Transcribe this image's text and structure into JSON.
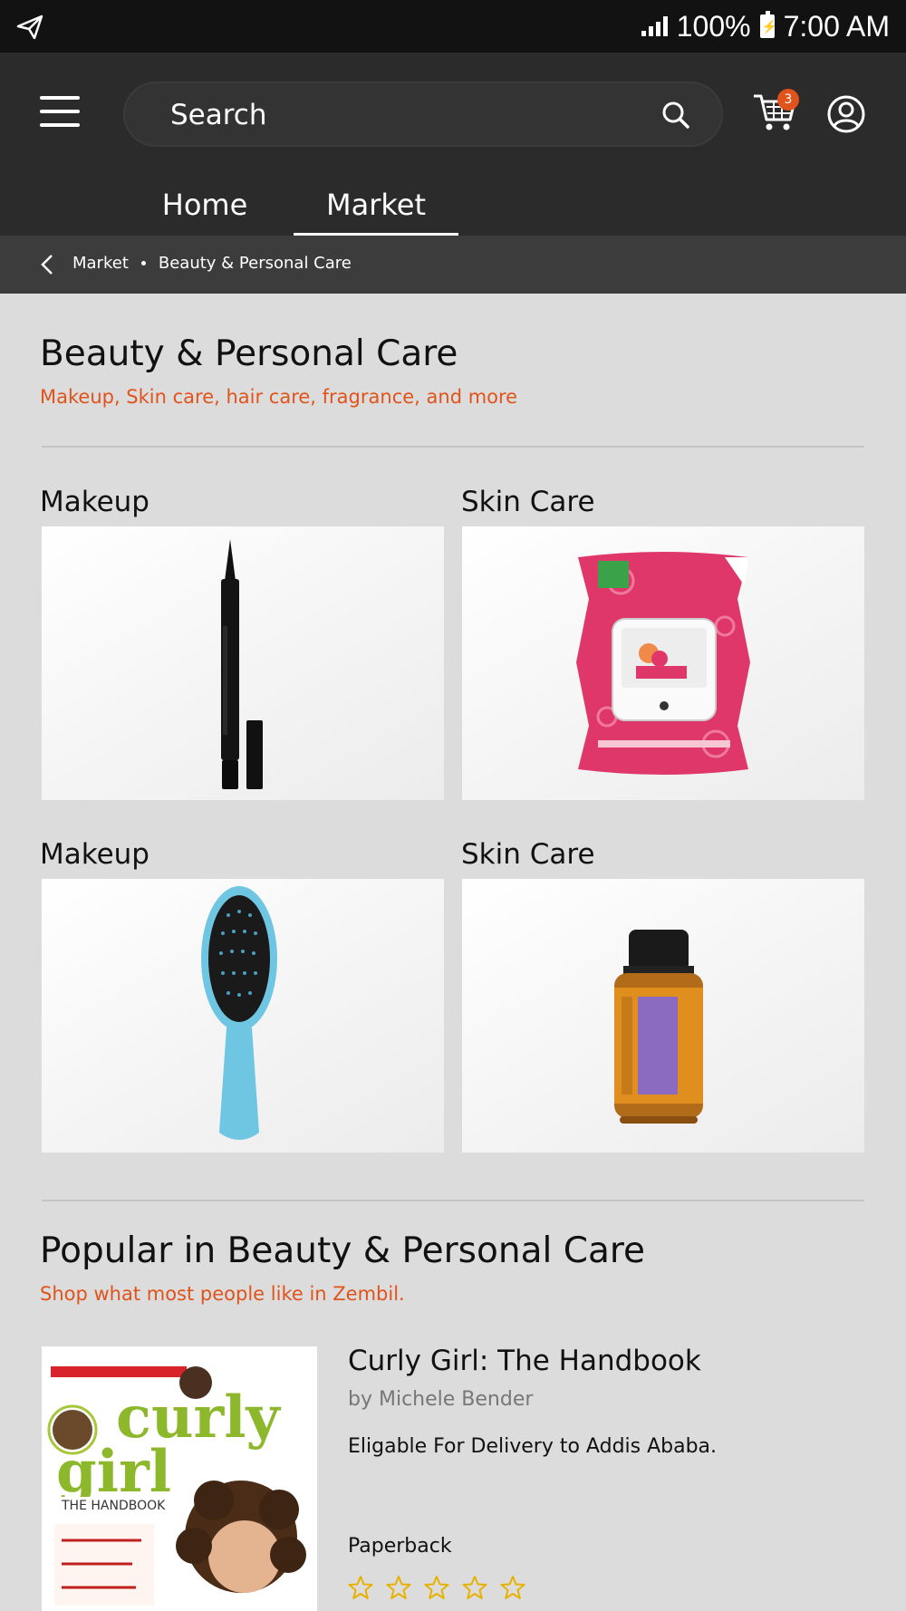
{
  "status_bar": {
    "battery": "100%",
    "time": "7:00 AM"
  },
  "header": {
    "search_placeholder": "Search",
    "cart_count": "3",
    "tabs": [
      {
        "label": "Home"
      },
      {
        "label": "Market"
      }
    ],
    "active_tab": "Market"
  },
  "breadcrumb": {
    "items": [
      "Market",
      "Beauty & Personal Care"
    ]
  },
  "category": {
    "title": "Beauty & Personal Care",
    "subtitle": "Makeup, Skin care, hair care, fragrance, and more",
    "tiles": [
      {
        "label": "Makeup",
        "image": "eyeliner-pen"
      },
      {
        "label": "Skin Care",
        "image": "facial-wipes-pack"
      },
      {
        "label": "Makeup",
        "image": "hair-brush"
      },
      {
        "label": "Skin Care",
        "image": "essential-oil-bottle"
      }
    ]
  },
  "popular": {
    "title": "Popular in Beauty & Personal Care",
    "subtitle": "Shop what most people like in Zembil.",
    "items": [
      {
        "title": "Curly Girl: The Handbook",
        "author": "by Michele Bender",
        "delivery": "Eligable For Delivery to Addis Ababa.",
        "format": "Paperback",
        "rating_stars": 5,
        "cover_image": "curly-girl-book-cover"
      }
    ]
  },
  "colors": {
    "accent": "#e0531a",
    "header_bg": "#2b2b2b",
    "breadcrumb_bg": "#3c3c3c",
    "page_bg": "#dcdcdc",
    "star": "#e8b100"
  }
}
